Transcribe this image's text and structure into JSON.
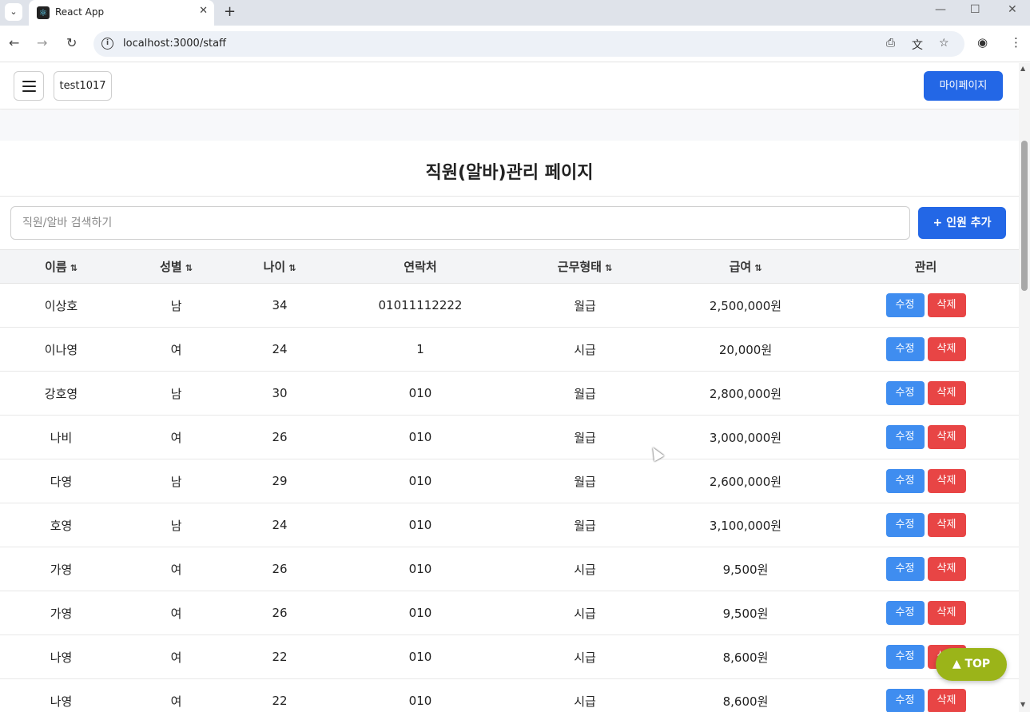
{
  "browser": {
    "tab_title": "React App",
    "new_tab_symbol": "+",
    "url": "localhost:3000/staff"
  },
  "header": {
    "username": "test1017",
    "mypage_label": "마이페이지"
  },
  "page": {
    "title": "직원(알바)관리 페이지",
    "search_placeholder": "직원/알바 검색하기",
    "add_button_label": "+ 인원 추가",
    "top_button_label": "▲ TOP"
  },
  "table": {
    "columns": [
      {
        "label": "이름",
        "sortable": true
      },
      {
        "label": "성별",
        "sortable": true
      },
      {
        "label": "나이",
        "sortable": true
      },
      {
        "label": "연락처",
        "sortable": false
      },
      {
        "label": "근무형태",
        "sortable": true
      },
      {
        "label": "급여",
        "sortable": true
      },
      {
        "label": "관리",
        "sortable": false
      }
    ],
    "sort_icon": "⇅",
    "edit_label": "수정",
    "delete_label": "삭제",
    "rows": [
      {
        "name": "이상호",
        "gender": "남",
        "age": "34",
        "phone": "01011112222",
        "type": "월급",
        "pay": "2,500,000원"
      },
      {
        "name": "이나영",
        "gender": "여",
        "age": "24",
        "phone": "1",
        "type": "시급",
        "pay": "20,000원"
      },
      {
        "name": "강호영",
        "gender": "남",
        "age": "30",
        "phone": "010",
        "type": "월급",
        "pay": "2,800,000원"
      },
      {
        "name": "나비",
        "gender": "여",
        "age": "26",
        "phone": "010",
        "type": "월급",
        "pay": "3,000,000원"
      },
      {
        "name": "다영",
        "gender": "남",
        "age": "29",
        "phone": "010",
        "type": "월급",
        "pay": "2,600,000원"
      },
      {
        "name": "호영",
        "gender": "남",
        "age": "24",
        "phone": "010",
        "type": "월급",
        "pay": "3,100,000원"
      },
      {
        "name": "가영",
        "gender": "여",
        "age": "26",
        "phone": "010",
        "type": "시급",
        "pay": "9,500원"
      },
      {
        "name": "가영",
        "gender": "여",
        "age": "26",
        "phone": "010",
        "type": "시급",
        "pay": "9,500원"
      },
      {
        "name": "나영",
        "gender": "여",
        "age": "22",
        "phone": "010",
        "type": "시급",
        "pay": "8,600원"
      },
      {
        "name": "나영",
        "gender": "여",
        "age": "22",
        "phone": "010",
        "type": "시급",
        "pay": "8,600원"
      }
    ]
  },
  "colors": {
    "primary": "#2367e6",
    "edit": "#3f8df0",
    "delete": "#e84545",
    "top_button": "#9bb419"
  }
}
